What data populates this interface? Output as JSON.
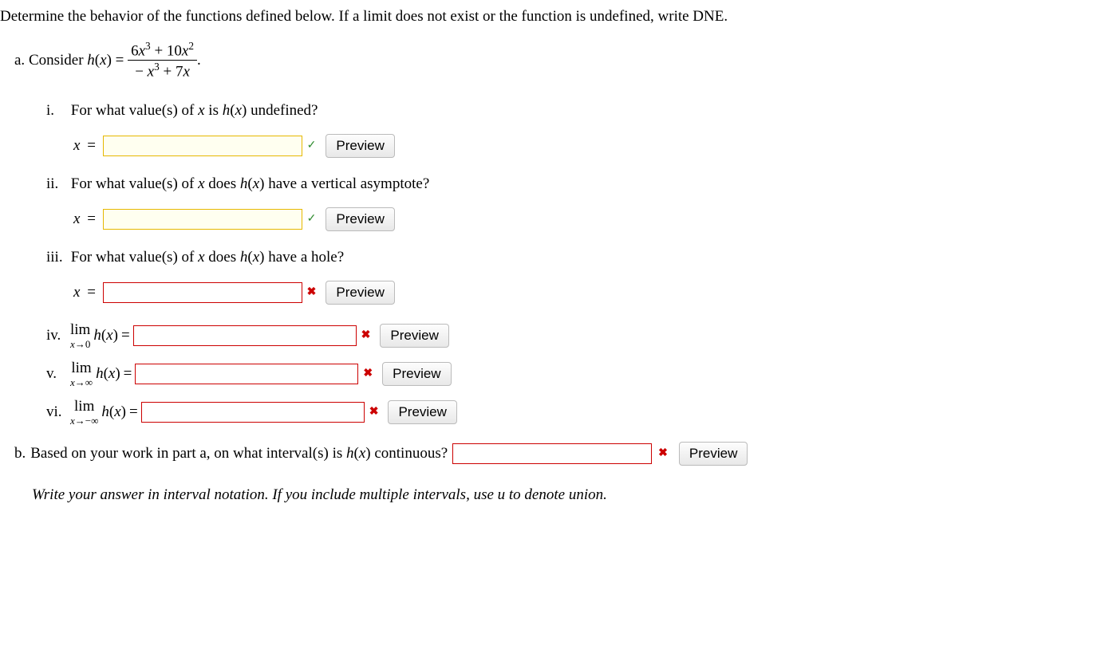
{
  "intro": "Determine the behavior of the functions defined below. If a limit does not exist or the function is undefined, write DNE.",
  "partA": {
    "label": "a.",
    "lead": "Consider",
    "func": "h(x)",
    "eq": "=",
    "numerator_html": "6x³ + 10x²",
    "denominator_html": "− x³ + 7x",
    "period": "."
  },
  "items": {
    "i": {
      "roman": "i.",
      "q": "For what value(s) of x is h(x) undefined?",
      "prefix": "x =",
      "status": "correct"
    },
    "ii": {
      "roman": "ii.",
      "q": "For what value(s) of x does h(x) have a vertical asymptote?",
      "prefix": "x =",
      "status": "correct"
    },
    "iii": {
      "roman": "iii.",
      "q": "For what value(s) of x does h(x) have a hole?",
      "prefix": "x =",
      "status": "incorrect"
    },
    "iv": {
      "roman": "iv.",
      "lim_sub": "x→0",
      "status": "incorrect"
    },
    "v": {
      "roman": "v.",
      "lim_sub": "x→∞",
      "status": "incorrect"
    },
    "vi": {
      "roman": "vi.",
      "lim_sub": "x→−∞",
      "status": "incorrect"
    }
  },
  "limit_label_top": "lim",
  "limit_func": "h(x)",
  "limit_eq": "=",
  "partB": {
    "label": "b.",
    "text": "Based on your work in part a, on what interval(s) is h(x) continuous?",
    "status": "incorrect"
  },
  "hint": "Write your answer in interval notation. If you include multiple intervals, use u to denote union.",
  "preview_label": "Preview",
  "marks": {
    "correct": "✓",
    "incorrect": "✖"
  }
}
